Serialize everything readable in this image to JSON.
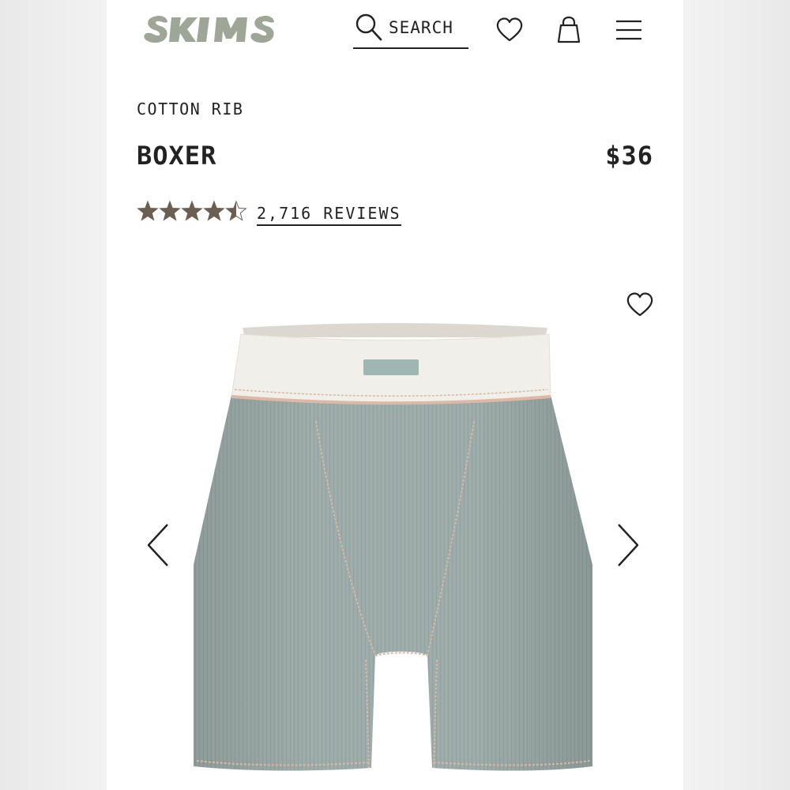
{
  "header": {
    "brand": "SKIMS",
    "search_label": "SEARCH",
    "icons": [
      "search-icon",
      "heart-icon",
      "shopping-bag-icon",
      "hamburger-menu-icon"
    ]
  },
  "product": {
    "collection": "COTTON RIB",
    "name": "BOXER",
    "price": "$36",
    "rating": 4.5,
    "rating_max": 5,
    "reviews_label": "2,716 REVIEWS"
  },
  "gallery": {
    "icons": [
      "heart-icon",
      "chevron-left-icon",
      "chevron-right-icon"
    ],
    "product_color": "#9eadab"
  },
  "colors": {
    "logo": "#9ea797",
    "text": "#222222",
    "star": "#6b5e53"
  }
}
